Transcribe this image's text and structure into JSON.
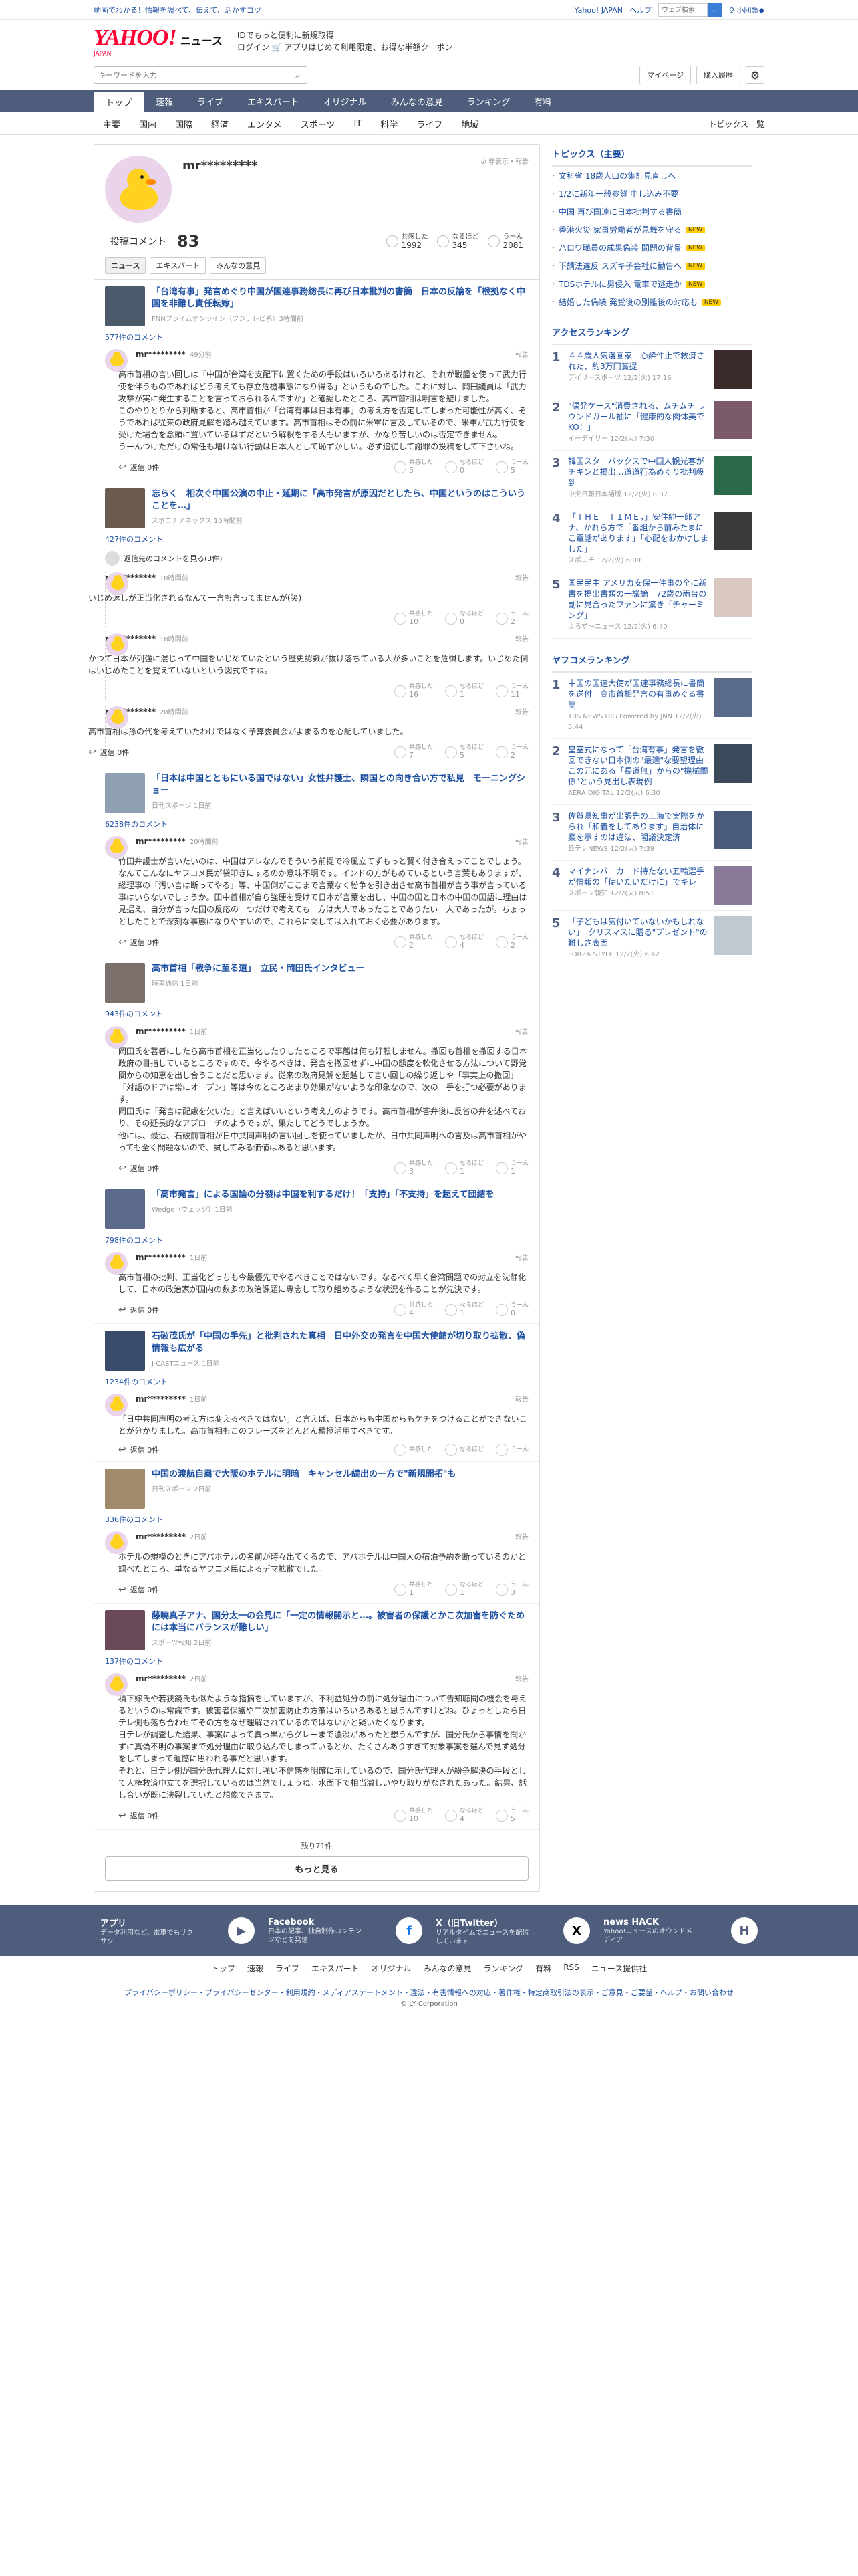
{
  "top": {
    "promo": "動画でわかる！情報を調べて、伝えて、活かすコツ",
    "links": [
      "Yahoo! JAPAN",
      "ヘルプ"
    ],
    "search_placeholder": "ウェブ検索",
    "user": "♀ 小団急◆"
  },
  "header": {
    "logo_main": "YAHOO!",
    "logo_sub": "JAPAN",
    "logo_news": "ニュース",
    "promo_line1": "IDでもっと便利に新規取得",
    "promo_line2": "ログイン 🛒 アプリはじめて利用限定、お得な半額クーポン"
  },
  "search": {
    "placeholder": "キーワードを入力",
    "mypage": "マイページ",
    "purchase": "購入履歴"
  },
  "nav": [
    "トップ",
    "速報",
    "ライブ",
    "エキスパート",
    "オリジナル",
    "みんなの意見",
    "ランキング",
    "有料"
  ],
  "subnav": [
    "主要",
    "国内",
    "国際",
    "経済",
    "エンタメ",
    "スポーツ",
    "IT",
    "科学",
    "ライフ",
    "地域"
  ],
  "subnav_right": "トピックス一覧",
  "profile": {
    "name": "mr*********",
    "report": "⊘ 非表示・報告",
    "comment_label": "投稿コメント",
    "comment_count": "83",
    "reacts": [
      {
        "label": "共感した",
        "value": "1992"
      },
      {
        "label": "なるほど",
        "value": "345"
      },
      {
        "label": "うーん",
        "value": "2081"
      }
    ],
    "tabs": [
      "ニュース",
      "エキスパート",
      "みんなの意見"
    ]
  },
  "comments": [
    {
      "title": "「台湾有事」発言めぐり中国が国連事務総長に再び日本批判の書簡　日本の反論を「根拠なく中国を非難し責任転嫁」",
      "source": "FNNプライムオンライン（フジテレビ系）3時間前",
      "count": "577件のコメント",
      "name": "mr*********",
      "time": "49分前",
      "report": "報告",
      "text": "高市首相の言い回しは「中国が台湾を支配下に置くための手段はいろいろあるけれど、それが戦艦を使って武力行使を伴うものであればどう考えても存立危機事態になり得る」というものでした。これに対し、岡田議員は「武力攻撃が実に発生することを言っておられるんですか」と確認したところ、高市首相は明言を避けました。\nこのやりとりから判断すると、高市首相が「台湾有事は日本有事」の考え方を否定してしまった可能性が高く、そうであれば従来の政府見解を踏み越えています。高市首相はその前に米軍に言及しているので、米軍が武力行使を受けた場合を念頭に置いているはずだという解釈をする人もいますが、かなり苦しいのは否定できません。\nうーんつけただけの常任も増けない行動は日本人として恥ずかしい。必ず追従して謝罪の投稿をして下さいね。",
      "reply": "返信 0件",
      "r": [
        "5",
        "0",
        "5"
      ]
    },
    {
      "title": "忘らく　相次ぐ中国公演の中止・延期に「高市発言が原因だとしたら、中国というのはこういうことを…」",
      "source": "スポニチアネックス 10時間前",
      "count": "427件のコメント",
      "replies_label": "返信先のコメントを見る(3件)",
      "subs": [
        {
          "name": "mr*********",
          "time": "18時間前",
          "text": "いじめ返しが正当化されるなんて一言も言ってませんが(笑)",
          "r": [
            "10",
            "0",
            "2"
          ]
        },
        {
          "name": "mr*********",
          "time": "18時間前",
          "text": "かつて日本が列強に混じって中国をいじめていたという歴史認識が抜け落ちている人が多いことを危惧します。いじめた側はいじめたことを覚えていないという図式ですね。",
          "r": [
            "16",
            "1",
            "11"
          ]
        },
        {
          "name": "mr*********",
          "time": "20時間前",
          "text": "高市首相は孫の代を考えていたわけではなく予算委員会がよまるのを心配していました。",
          "r": [
            "7",
            "5",
            "2"
          ]
        }
      ]
    },
    {
      "title": "「日本は中国とともにいる国ではない」女性弁護士、隣国との向き合い方で私見　モーニングショー",
      "source": "日刊スポーツ 1日前",
      "count": "6238件のコメント",
      "name": "mr*********",
      "time": "20時間前",
      "report": "報告",
      "text": "竹田弁護士が言いたいのは、中国はアレなんでそういう前提で冷風立てずもっと賢く付き合えってことでしょう。なんてこんなにヤフコメ民が袋叩きにするのか意味不明です。インドの方がもめているという言葉もありますが、総理事の「汚い言は断ってやる」等、中国側がここまで言葉なく紛争を引き出させ高市首相が言う事が言っている事はいらないでしょうか。田中首相が自ら強硬を受けて日本が言葉を出し、中国の国と日本の中国の国語に理由は見据え、自分が言った国の反応の一つだけで考えても一方は大人であったことでありたい一人であったが。ちょっとしたことで深刻な事態になりやすいので、これらに関しては入れておく必要があります。",
      "reply": "返信 0件",
      "r": [
        "2",
        "4",
        "2"
      ]
    },
    {
      "title": "高市首相「戦争に至る道」　立民・岡田氏インタビュー",
      "source": "時事通信 1日前",
      "count": "943件のコメント",
      "name": "mr*********",
      "time": "1日前",
      "report": "報告",
      "text": "岡田氏を著者にしたら高市首相を正当化したりしたところで事態は何も好転しません。撤回も首相を撤回する日本政府の目指しているところですので、今やるべきは、発言を撤回せずに中国の態度を軟化させる方法について野党間からの知恵を出し合うことだと思います。従来の政府見解を超越して言い回しの繰り返しや「事実上の撤回」「対話のドアは常にオープン」等は今のところあまり効果がないような印象なので、次の一手を打つ必要があります。\n岡田氏は「発言は配慮を欠いた」と言えばいいという考え方のようです。高市首相が答弁後に反省の弁を述べており、その延長的なアプローチのようですが、果たしてどうでしょうか。\n他には、最近、石破前首相が日中共同声明の言い回しを使っていましたが、日中共同声明への言及は高市首相がやっても全く問題ないので、試してみる価値はあると思います。",
      "reply": "返信 0件",
      "r": [
        "3",
        "1",
        "1"
      ]
    },
    {
      "title": "「高市発言」による国論の分裂は中国を利するだけ！「支持」「不支持」を超えて団結を",
      "source": "Wedge（ウェッジ）1日前",
      "count": "798件のコメント",
      "name": "mr*********",
      "time": "1日前",
      "report": "報告",
      "text": "高市首相の批判、正当化どっちも今最優先でやるべきことではないです。なるべく早く台湾問題での対立を沈静化して、日本の政治家が国内の数多の政治課題に専念して取り組めるような状況を作ることが先決です。",
      "reply": "返信 0件",
      "r": [
        "4",
        "1",
        "0"
      ]
    },
    {
      "title": "石破茂氏が「中国の手先」と批判された真相　日中外交の発言を中国大使館が切り取り拡散、偽情報も広がる",
      "source": "J-CASTニュース 1日前",
      "count": "1234件のコメント",
      "name": "mr*********",
      "time": "1日前",
      "report": "報告",
      "text": "「日中共同声明の考え方は変えるべきではない」と言えば、日本からも中国からもケチをつけることができないことが分かりました。高市首相もこのフレーズをどんどん積極活用すべきです。",
      "reply": "返信 0件",
      "r": [
        "",
        "",
        ""
      ]
    },
    {
      "title": "中国の渡航自粛で大阪のホテルに明暗　キャンセル続出の一方で\"新規開拓\"も",
      "source": "日刊スポーツ 2日前",
      "count": "336件のコメント",
      "name": "mr*********",
      "time": "2日前",
      "report": "報告",
      "text": "ホテルの規模のときにアパホテルの名前が時々出てくるので、アパホテルは中国人の宿泊予約を断っているのかと調べたところ、単なるヤフコメ民によるデマ拡散でした。",
      "reply": "返信 0件",
      "r": [
        "1",
        "1",
        "3"
      ]
    },
    {
      "title": "藤曉真子アナ、国分太一の会見に「一定の情報開示と…。被害者の保護とかこ次加害を防ぐためには本当にバランスが難しい」",
      "source": "スポーツ報知 2日前",
      "count": "137件のコメント",
      "name": "mr*********",
      "time": "2日前",
      "report": "報告",
      "text": "積下嫁氏や若狭鏡氏も似たような指摘をしていますが、不利益処分の前に処分理由について告知聴聞の機会を与えるというのは常識です。被害者保護や二次加害防止の方策はいろいろあると思うんですけどね。ひょっとしたら日テレ側も落ち合わせてその方をなぜ理解されているのではないかと疑いたくなります。\n日テレが調査した結果、事案によって真っ黒からグレーまで濃淡があったと想うんですが、国分氏から事情を聞かずに真偽不明の事案まで処分理由に取り込んでしまっているとか、たくさんありすぎて対象事案を選んで見ず処分をしてしまって遺憾に思われる事だと思います。\nそれと、日テレ側が国分氏代理人に対し強い不信感を明確に示しているので、国分氏代理人が紛争解決の手段として人権救済申立てを選択しているのは当然でしょうね。水面下で相当激しいやり取りがなされたあった。結果、話し合いが既に決裂していたと想像できます。",
      "reply": "返信 0件",
      "r": [
        "10",
        "4",
        "5"
      ]
    }
  ],
  "more": {
    "count": "残り71件",
    "button": "もっと見る"
  },
  "right": {
    "topics_title": "トピックス（主要）",
    "topics": [
      {
        "t": "文科省 18歳人口の集計見直しへ",
        "b": ""
      },
      {
        "t": "1/2に新年一般参賀 申し込み不要",
        "b": ""
      },
      {
        "t": "中国 再び国連に日本批判する書簡",
        "b": ""
      },
      {
        "t": "香港火災 家事労働者が見舞を守る",
        "b": "NEW"
      },
      {
        "t": "ハロワ職員の成果偽装 問題の背景",
        "b": "NEW"
      },
      {
        "t": "下請法違反 スズキ子会社に勧告へ",
        "b": "NEW"
      },
      {
        "t": "TDSホテルに男侵入 電車で逃走か",
        "b": "NEW"
      },
      {
        "t": "結婚した偽装 発覚後の別離後の対応も",
        "b": "NEW"
      }
    ],
    "access_title": "アクセスランキング",
    "access": [
      {
        "t": "４４歳人気漫画家　心酔件止で救済された、約3万円賞提",
        "s": "デイリースポーツ 12/2(火) 17:16"
      },
      {
        "t": "\"偶発ケース\"消費される、ムチムチ ラウンドガール袖に「健康的な肉体美でKO！」",
        "s": "イーデイリー 12/2(火) 7:30"
      },
      {
        "t": "韓国スターバックスで中国人観光客がチキンと掲出…道道行為めぐり批判殺到",
        "s": "中央日報日本語版 12/2(火) 8:37"
      },
      {
        "t": "「ＴＨＥ　ＴＩＭＥ，」安住紳一郎アナ、かれら方で「番組から前みたまにこ電話があります」「心配をおかけしました」",
        "s": "スポニチ 12/2(火) 6:09"
      },
      {
        "t": "国民民主 アメリカ安保一件事の全に新書を提出書類の一議論　72歳の雨台の副に見合ったファンに驚き「チャーミング」",
        "s": "よろず～ニュース 12/2(火) 6:40"
      }
    ],
    "yahoo_title": "ヤフコメランキング",
    "yahoo": [
      {
        "t": "中国の国連大使が国連事務総長に書簡を送付　高市首相発言の有事めぐる書簡",
        "s": "TBS NEWS DIG Powered by JNN 12/2(火) 5:44"
      },
      {
        "t": "皇室式になって「台湾有事」発言を徹回できない日本側の\"最適\"な要望理由　この元にある「長道無」からの\"機械関係\"という見出し表現例",
        "s": "AERA DIGITAL 12/2(火) 6:30"
      },
      {
        "t": "佐賀県知事が出張先の上海で実際をかられ「和義をしてあります」自治体に案を示すのは違法、閣議決定済",
        "s": "日テレNEWS 12/2(火) 7:39"
      },
      {
        "t": "マイナンバーカード持たない五輪選手が情報の「使いたいだけに」でキレ",
        "s": "スポーツ報知 12/2(火) 8:51"
      },
      {
        "t": "「子どもは気付いていないかもしれない」　クリスマスに贈る\"プレゼント\"の難しさ表面",
        "s": "FORZA STYLE 12/2(火) 6:42"
      }
    ]
  },
  "footer": {
    "blocks": [
      {
        "t": "アプリ",
        "s": "データ利用など、電車でもサクサク",
        "icon": "▶"
      },
      {
        "t": "Facebook",
        "s": "日本の記事、独自制作コンテンツなどを発信",
        "icon": "f"
      },
      {
        "t": "X（旧Twitter）",
        "s": "リアルタイムでニュースを配信しています",
        "icon": "X"
      },
      {
        "t": "news HACK",
        "s": "Yahoo!ニュースのオウンドメディア",
        "icon": "H"
      }
    ],
    "nav": [
      "トップ",
      "速報",
      "ライブ",
      "エキスパート",
      "オリジナル",
      "みんなの意見",
      "ランキング",
      "有料",
      "RSS",
      "ニュース提供社"
    ],
    "links": "プライバシーポリシー・プライバシーセンター・利用規約・メディアステートメント・違法・有害情報への対応・著作権・特定商取引法の表示・ご意見・ご要望・ヘルプ・お問い合わせ",
    "copy": "© LY Corporation"
  },
  "colors": {
    "nav": "#4d5d7b",
    "link": "#1e50a2",
    "accent": "#ff0033"
  }
}
